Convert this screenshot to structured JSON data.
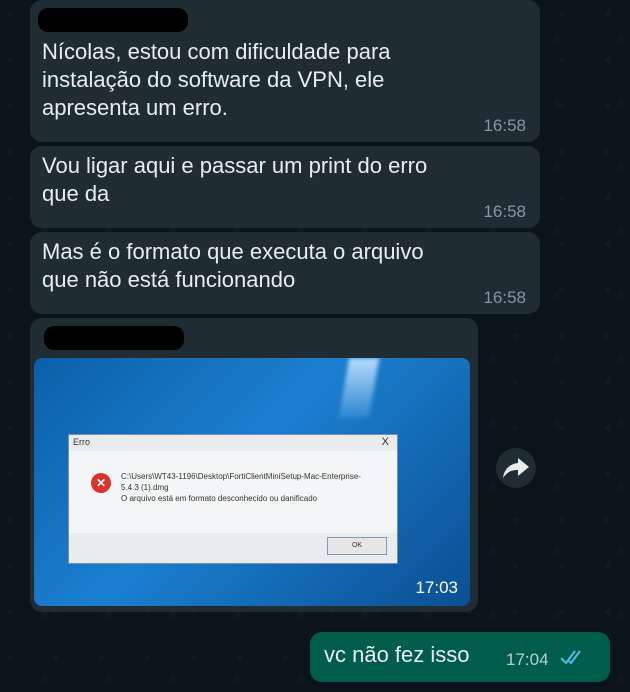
{
  "messages": [
    {
      "text": "Nícolas, estou com dificuldade para\ninstalação do software da VPN, ele\napresenta um erro.",
      "time": "16:58"
    },
    {
      "text": "Vou ligar aqui e passar um print do erro\nque da",
      "time": "16:58"
    },
    {
      "text": "Mas é o formato que executa o arquivo\nque não está funcionando",
      "time": "16:58"
    }
  ],
  "photo_message": {
    "time": "17:03",
    "dialog": {
      "title": "Erro",
      "close": "X",
      "path_line1": "C:\\Users\\WT43-1196\\Desktop\\FortiClientMiniSetup-Mac-Enterprise-",
      "path_line2": "5.4.3 (1).dmg",
      "error": "O arquivo está em formato desconhecido ou danificado",
      "ok_label": "OK"
    }
  },
  "outgoing": {
    "text": "vc não fez isso",
    "time": "17:04"
  },
  "icons": {
    "forward": "forward-icon",
    "error": "error-x-icon",
    "read_receipt": "double-check-icon"
  },
  "colors": {
    "incoming_bubble": "#1f2c34",
    "outgoing_bubble": "#005c4b",
    "read_tick": "#53bdeb"
  }
}
